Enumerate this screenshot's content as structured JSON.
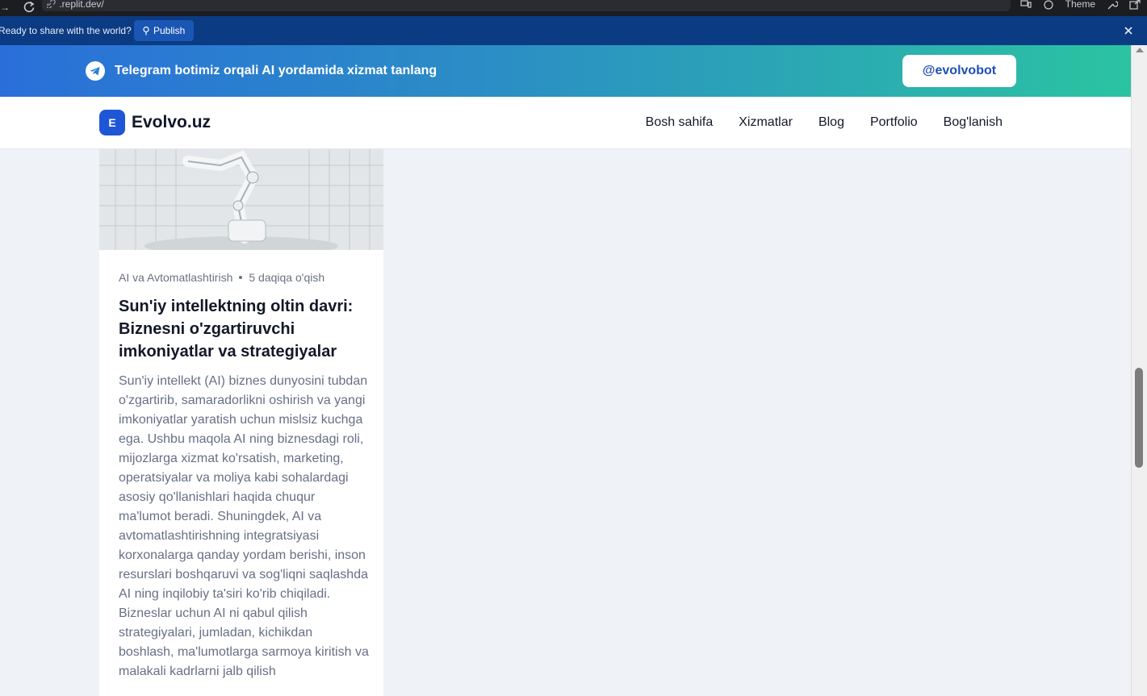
{
  "browser": {
    "url": ".replit.dev/",
    "theme_label": "Theme"
  },
  "publish_bar": {
    "message": "Ready to share with the world?",
    "publish_label": "Publish"
  },
  "telegram_banner": {
    "text": "Telegram botimiz orqali AI yordamida xizmat tanlang",
    "button_label": "@evolvobot"
  },
  "header": {
    "logo_letter": "E",
    "logo_text": "Evolvo.uz",
    "nav": [
      "Bosh sahifa",
      "Xizmatlar",
      "Blog",
      "Portfolio",
      "Bog'lanish"
    ]
  },
  "article": {
    "category": "AI va Avtomatlashtirish",
    "read_time": "5 daqiqa o'qish",
    "title": "Sun'iy intellektning oltin davri: Biznesni o'zgartiruvchi imkoniyatlar va strategiyalar",
    "excerpt": "Sun'iy intellekt (AI) biznes dunyosini tubdan o'zgartirib, samaradorlikni oshirish va yangi imkoniyatlar yaratish uchun mislsiz kuchga ega. Ushbu maqola AI ning biznesdagi roli, mijozlarga xizmat ko'rsatish, marketing, operatsiyalar va moliya kabi sohalardagi asosiy qo'llanishlari haqida chuqur ma'lumot beradi. Shuningdek, AI va avtomatlashtirishning integratsiyasi korxonalarga qanday yordam berishi, inson resurslari boshqaruvi va sog'liqni saqlashda AI ning inqilobiy ta'siri ko'rib chiqiladi. Bizneslar uchun AI ni qabul qilish strategiyalari, jumladan, kichikdan boshlash, ma'lumotlarga sarmoya kiritish va malakali kadrlarni jalb qilish"
  },
  "colors": {
    "publish_bar_bg": "#0b3b82",
    "banner_start": "#2a6fd9",
    "banner_end": "#2bc3a2",
    "logo_bg": "#1e56d6",
    "page_bg": "#eff2f6"
  }
}
